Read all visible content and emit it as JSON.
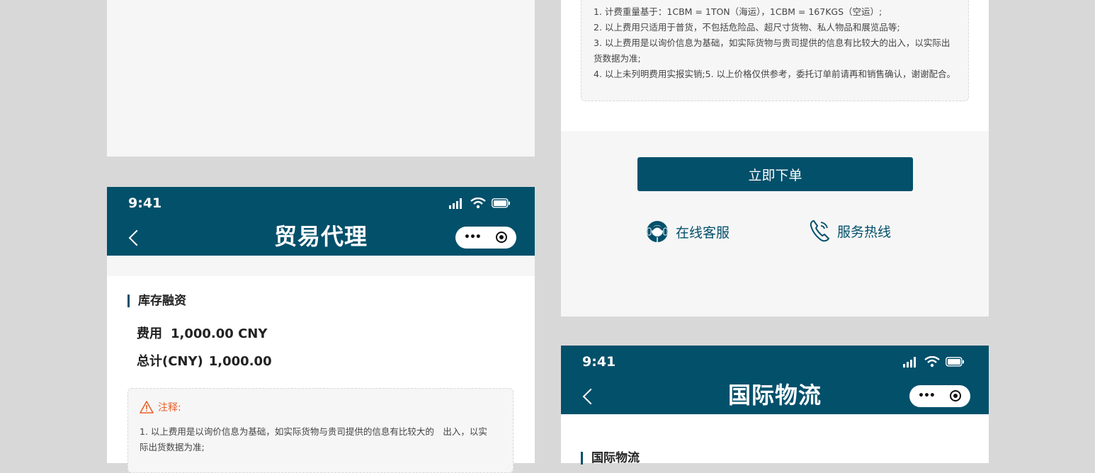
{
  "colors": {
    "brand": "#03506b",
    "warning": "#e8612c",
    "background": "#d8d8d8",
    "panel": "#f6f6f6"
  },
  "status_bar": {
    "time": "9:41"
  },
  "trade_agent_screen": {
    "title": "贸易代理",
    "section_title": "库存融资",
    "fee_label": "费用",
    "fee_value": "1,000.00 CNY",
    "total_label": "总计(CNY)",
    "total_value": "1,000.00",
    "note_title": "注释:",
    "note_lines": [
      "1. 以上费用是以询价信息为基础，如实际货物与贵司提供的信息有比较大的　出入，以实",
      "际出货数据为准;"
    ]
  },
  "order_screen": {
    "note_lines": [
      "1. 计费重量基于：1CBM = 1TON（海运），1CBM = 167KGS（空运）;",
      "2. 以上费用只适用于普货，不包括危险品、超尺寸货物、私人物品和展览品等;",
      "3. 以上费用是以询价信息为基础，如实际货物与贵司提供的信息有比较大的出入，以实际出",
      "货数据为准;",
      "4. 以上未列明费用实报实销;5. 以上价格仅供参考，委托订单前请再和销售确认，谢谢配合。"
    ],
    "order_button": "立即下单",
    "online_service": "在线客服",
    "hotline": "服务热线"
  },
  "logistics_screen": {
    "title": "国际物流",
    "section_title": "国际物流"
  },
  "icons": [
    "back-icon",
    "signal-icon",
    "wifi-icon",
    "battery-icon",
    "more-icon",
    "close-icon",
    "warning-icon",
    "headset-icon",
    "phone-icon"
  ]
}
